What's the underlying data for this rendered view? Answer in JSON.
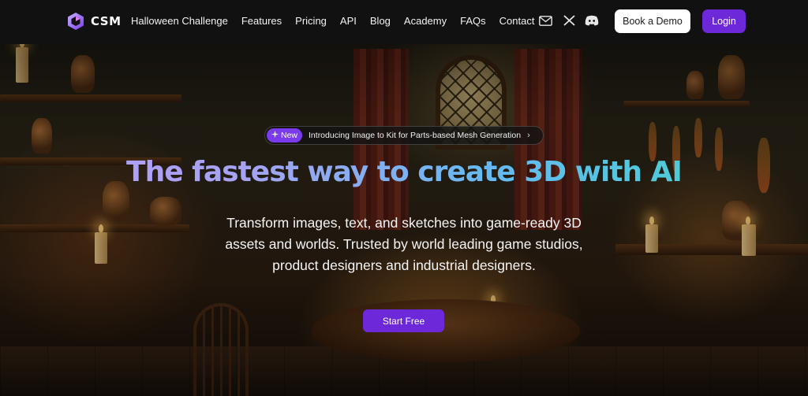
{
  "brand": {
    "name": "CSM"
  },
  "nav": {
    "items": [
      {
        "label": "Halloween Challenge"
      },
      {
        "label": "Features"
      },
      {
        "label": "Pricing"
      },
      {
        "label": "API"
      },
      {
        "label": "Blog"
      },
      {
        "label": "Academy"
      },
      {
        "label": "FAQs"
      },
      {
        "label": "Contact"
      }
    ],
    "icons": [
      "mail-icon",
      "x-twitter-icon",
      "discord-icon"
    ],
    "demo_label": "Book a Demo",
    "login_label": "Login"
  },
  "hero": {
    "badge_label": "New",
    "announcement": "Introducing Image to Kit for Parts-based Mesh Generation",
    "headline": "The fastest way to create 3D with AI",
    "subtitle": "Transform  images, text, and sketches into game-ready 3D assets and worlds. Trusted by world leading game studios, product designers and industrial designers.",
    "cta_label": "Start Free"
  },
  "colors": {
    "accent": "#6d28d9",
    "badge": "#7c3aed",
    "nav_bg": "#111111",
    "headline_gradient": [
      "#b79bff",
      "#66b9f2",
      "#3fd6c8"
    ]
  }
}
